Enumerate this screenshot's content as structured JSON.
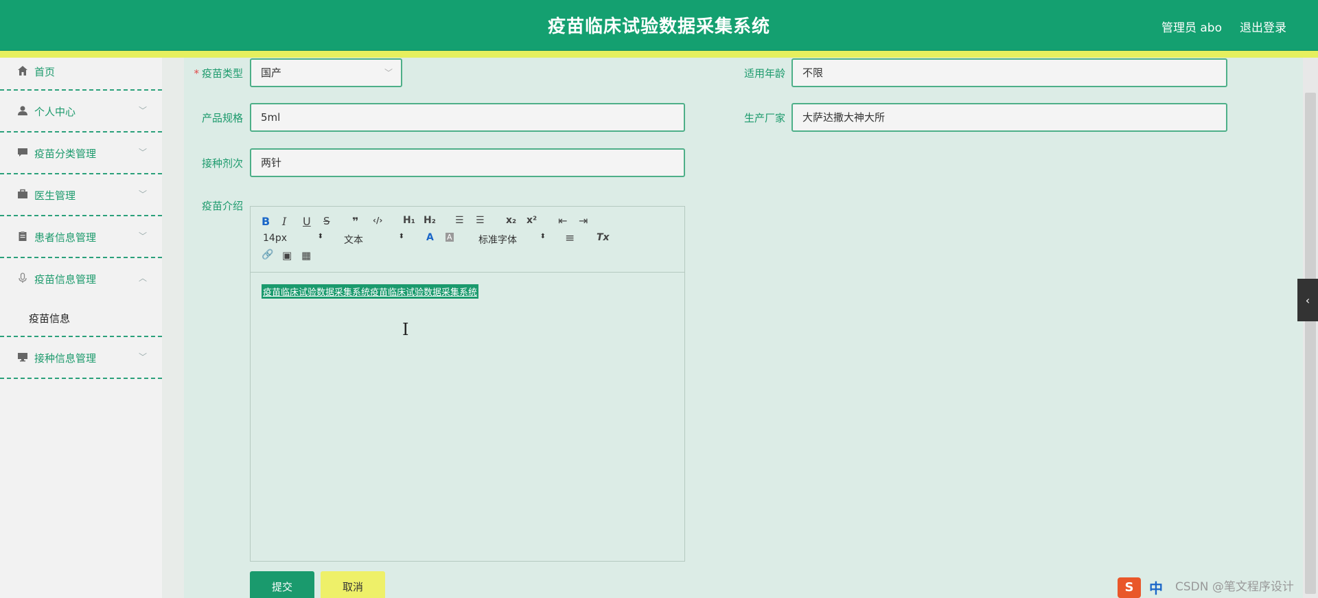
{
  "header": {
    "title": "疫苗临床试验数据采集系统",
    "user": "管理员 abo",
    "logout": "退出登录"
  },
  "sidebar": {
    "items": [
      {
        "label": "首页",
        "icon": "home-icon"
      },
      {
        "label": "个人中心",
        "icon": "user-icon"
      },
      {
        "label": "疫苗分类管理",
        "icon": "comment-icon"
      },
      {
        "label": "医生管理",
        "icon": "briefcase-icon"
      },
      {
        "label": "患者信息管理",
        "icon": "clipboard-icon"
      },
      {
        "label": "疫苗信息管理",
        "icon": "microphone-icon"
      },
      {
        "label": "接种信息管理",
        "icon": "monitor-icon"
      }
    ],
    "submenu": "疫苗信息"
  },
  "form": {
    "vaccine_type": {
      "label": "疫苗类型",
      "value": "国产"
    },
    "age": {
      "label": "适用年龄",
      "value": "不限"
    },
    "spec": {
      "label": "产品规格",
      "value": "5ml"
    },
    "manufacturer": {
      "label": "生产厂家",
      "value": "大萨达撒大神大所"
    },
    "doses": {
      "label": "接种剂次",
      "value": "两针"
    },
    "intro": {
      "label": "疫苗介绍"
    }
  },
  "editor": {
    "font_size": "14px",
    "text_type": "文本",
    "font_family": "标准字体",
    "content": "疫苗临床试验数据采集系统疫苗临床试验数据采集系统",
    "toolbar": {
      "bold": "B",
      "italic": "I",
      "underline": "U",
      "strike": "S",
      "quote": "❞",
      "code": "‹/›",
      "h1": "H₁",
      "h2": "H₂",
      "ordered": "☰",
      "bullet": "☰",
      "sub": "x₂",
      "sup": "x²",
      "indent_less": "⇤",
      "indent_more": "⇥",
      "color": "A",
      "bg": "A",
      "align": "≡",
      "clear": "Tx",
      "link": "🔗",
      "image": "▣",
      "video": "▦"
    }
  },
  "buttons": {
    "submit": "提交",
    "cancel": "取消"
  },
  "ime": {
    "s": "S",
    "zh": "中"
  },
  "watermark": "CSDN @笔文程序设计",
  "colors": {
    "primary": "#14a070",
    "accent_bar": "#e6ef5e",
    "cancel": "#eef069"
  }
}
